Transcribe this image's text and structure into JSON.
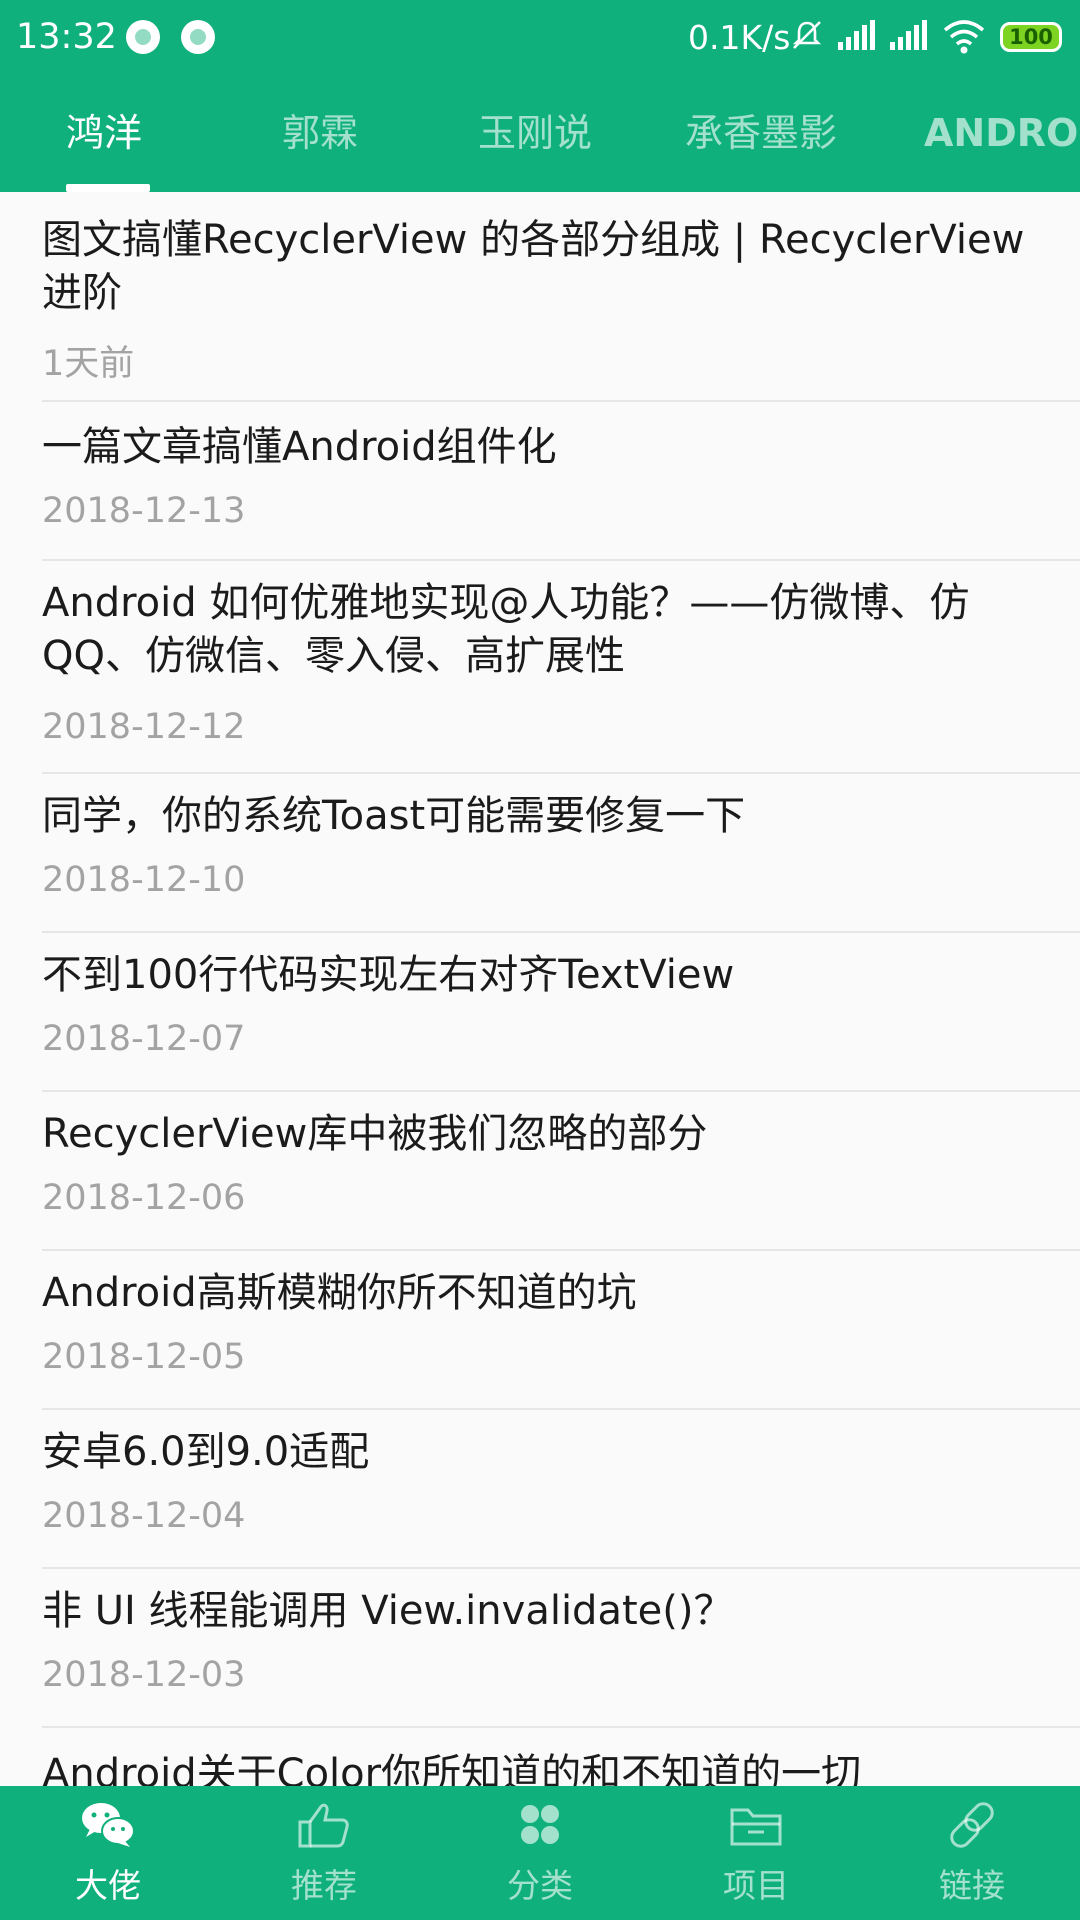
{
  "status_bar": {
    "time": "13:32",
    "network_speed": "0.1K/s",
    "battery": "100",
    "icons": [
      "notification-dot-icon",
      "notification-dot-icon",
      "mute-icon",
      "signal-icon",
      "signal-icon",
      "wifi-icon",
      "battery-icon"
    ]
  },
  "tabs": [
    {
      "label": "鸿洋",
      "active": true
    },
    {
      "label": "郭霖",
      "active": false
    },
    {
      "label": "玉刚说",
      "active": false
    },
    {
      "label": "承香墨影",
      "active": false
    },
    {
      "label": "ANDROID",
      "active": false
    }
  ],
  "articles": [
    {
      "title": "图文搞懂RecyclerView 的各部分组成 | RecyclerView进阶",
      "date": "1天前"
    },
    {
      "title": "一篇文章搞懂Android组件化",
      "date": "2018-12-13"
    },
    {
      "title": "Android 如何优雅地实现@人功能？——仿微博、仿QQ、仿微信、零入侵、高扩展性",
      "date": "2018-12-12"
    },
    {
      "title": "同学，你的系统Toast可能需要修复一下",
      "date": "2018-12-10"
    },
    {
      "title": "不到100行代码实现左右对齐TextView",
      "date": "2018-12-07"
    },
    {
      "title": "RecyclerView库中被我们忽略的部分",
      "date": "2018-12-06"
    },
    {
      "title": "Android高斯模糊你所不知道的坑",
      "date": "2018-12-05"
    },
    {
      "title": "安卓6.0到9.0适配",
      "date": "2018-12-04"
    },
    {
      "title": "非 UI 线程能调用 View.invalidate()？",
      "date": "2018-12-03"
    },
    {
      "title": "Android关于Color你所知道的和不知道的一切",
      "date": ""
    }
  ],
  "bottom_nav": [
    {
      "label": "大佬",
      "icon": "wechat-icon",
      "active": true
    },
    {
      "label": "推荐",
      "icon": "thumbs-up-icon",
      "active": false
    },
    {
      "label": "分类",
      "icon": "grid-icon",
      "active": false
    },
    {
      "label": "项目",
      "icon": "folder-icon",
      "active": false
    },
    {
      "label": "链接",
      "icon": "link-icon",
      "active": false
    }
  ],
  "colors": {
    "primary": "#0fb07b",
    "text": "#1b1b1b",
    "secondary_text": "#a3a3a3"
  }
}
